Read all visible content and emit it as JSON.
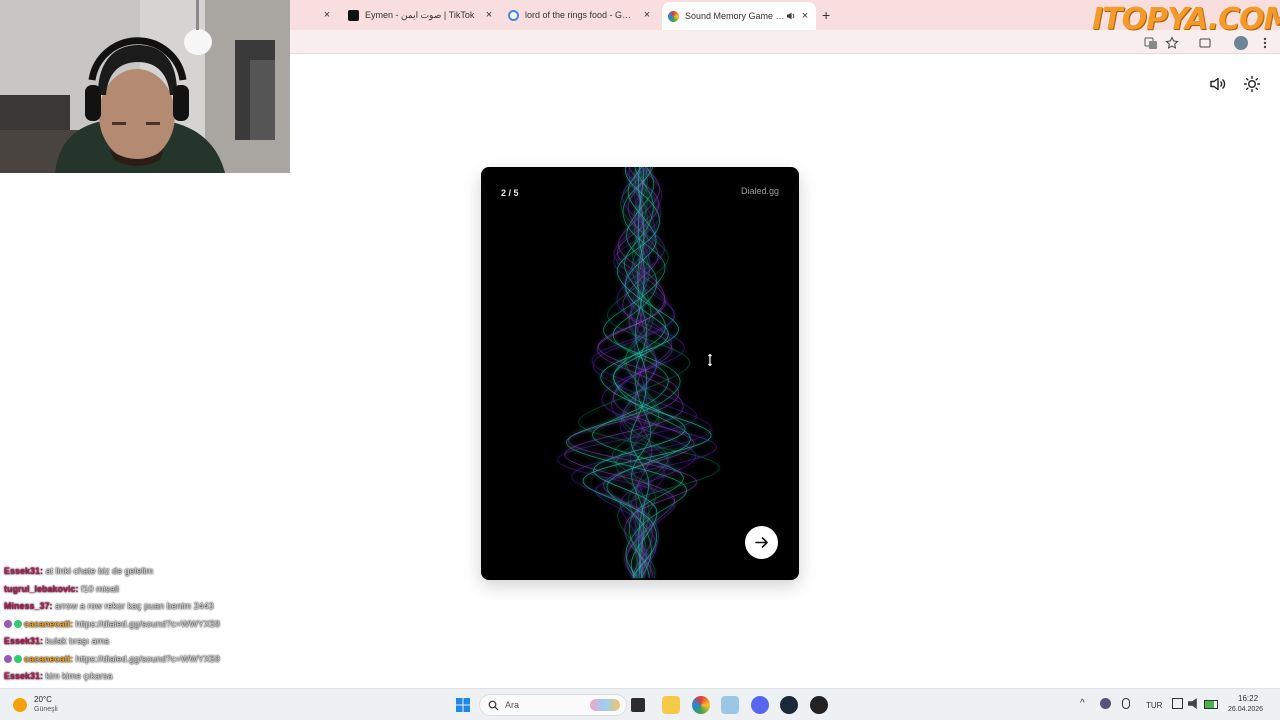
{
  "browser": {
    "tabs": [
      {
        "title": "",
        "active": false
      },
      {
        "title": "Eymen - صوت ايمن | TikTok",
        "active": false
      },
      {
        "title": "lord of the rings food - Google",
        "active": false
      },
      {
        "title": "Sound Memory Game — H",
        "active": true
      }
    ],
    "new_tab_symbol": "+",
    "close_symbol": "×"
  },
  "overlay": {
    "logo_text": "ITOPYA.COM"
  },
  "game": {
    "progress": "2 / 5",
    "brand": "Dialed.gg"
  },
  "chat": {
    "messages": [
      {
        "user": "Essek31:",
        "text": " at linki chate biz de gelelim",
        "color": "#c2185b"
      },
      {
        "user": "tugrul_lebakovic:",
        "text": " f10 misali",
        "color": "#c2185b"
      },
      {
        "user": "Miness_37:",
        "text": " arrow a row rekor kaç puan benim 2443",
        "color": "#c2185b"
      },
      {
        "user": "cacanecati:",
        "text": " https://dialed.gg/sound?c=WWYX59",
        "color": "#f5a623"
      },
      {
        "user": "Essek31:",
        "text": " kulak tıraşı ama",
        "color": "#c2185b"
      },
      {
        "user": "cacanecati:",
        "text": " https://dialed.gg/sound?c=WWYX59",
        "color": "#f5a623"
      },
      {
        "user": "Essek31:",
        "text": " kim kime çıkarsa",
        "color": "#c2185b"
      }
    ]
  },
  "taskbar": {
    "temperature": "20°C",
    "condition": "Güneşli",
    "search_placeholder": "Ara",
    "language": "TUR",
    "time": "16:22",
    "date": "26.04.2026"
  }
}
